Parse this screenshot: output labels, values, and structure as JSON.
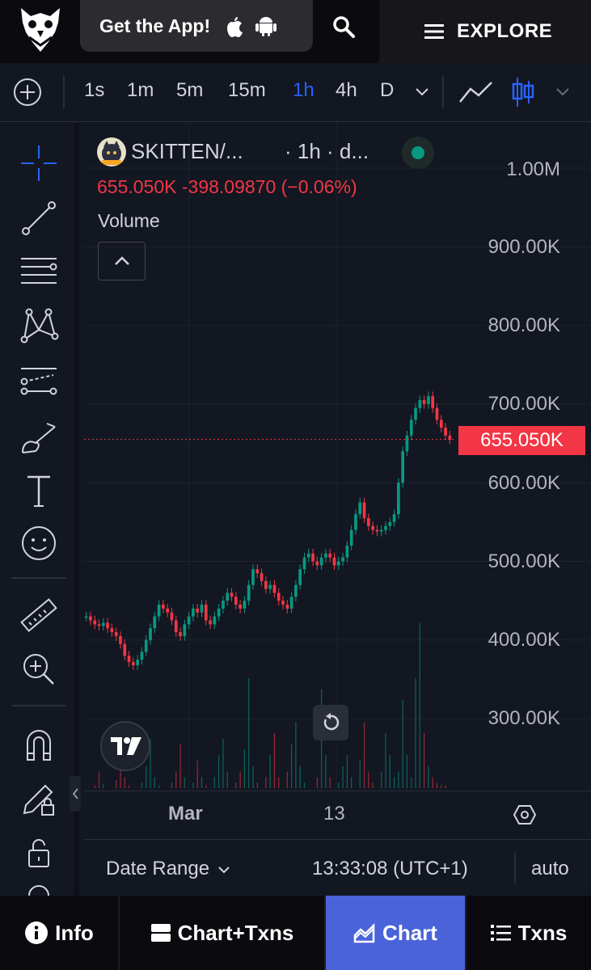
{
  "header": {
    "get_app_label": "Get the App!",
    "explore_label": "EXPLORE"
  },
  "toolbar": {
    "intervals": [
      "1s",
      "1m",
      "5m",
      "15m",
      "1h",
      "4h",
      "D"
    ],
    "active_interval": "1h"
  },
  "legend": {
    "symbol": "SKITTEN/...",
    "timeframe": "· 1h · d...",
    "ohlc": "655.050K  -398.09870 (−0.06%)",
    "volume_label": "Volume"
  },
  "price_axis": {
    "labels": [
      "1.00M",
      "900.00K",
      "800.00K",
      "700.00K",
      "600.00K",
      "500.00K",
      "400.00K",
      "300.00K"
    ],
    "current_price": "655.050K"
  },
  "time_axis": {
    "labels": [
      "Mar",
      "13"
    ]
  },
  "bottom_bar": {
    "date_range_label": "Date Range",
    "clock": "13:33:08 (UTC+1)",
    "scale_mode": "auto"
  },
  "tabs": [
    "Info",
    "Chart+Txns",
    "Chart",
    "Txns"
  ],
  "active_tab": "Chart",
  "colors": {
    "up": "#089981",
    "down": "#f23645",
    "accent": "#2962ff",
    "active_tab": "#4a63d9"
  },
  "chart_data": {
    "type": "candlestick",
    "ylim": [
      250000,
      1000000
    ],
    "price_series": [
      430000,
      425000,
      420000,
      418000,
      422000,
      415000,
      410000,
      405000,
      395000,
      380000,
      372000,
      368000,
      375000,
      385000,
      400000,
      415000,
      430000,
      445000,
      440000,
      435000,
      425000,
      410000,
      405000,
      420000,
      430000,
      440000,
      435000,
      445000,
      425000,
      420000,
      430000,
      440000,
      450000,
      460000,
      455000,
      445000,
      440000,
      450000,
      470000,
      490000,
      485000,
      475000,
      465000,
      470000,
      460000,
      450000,
      445000,
      440000,
      455000,
      470000,
      490000,
      505000,
      510000,
      500000,
      495000,
      505000,
      510000,
      505000,
      495000,
      500000,
      505000,
      520000,
      540000,
      560000,
      575000,
      555000,
      545000,
      540000,
      538000,
      540000,
      545000,
      550000,
      560000,
      600000,
      640000,
      660000,
      680000,
      695000,
      705000,
      700000,
      710000,
      695000,
      680000,
      670000,
      660000,
      655000
    ],
    "volume_spikes": [
      0,
      0,
      5,
      30,
      8,
      0,
      0,
      15,
      60,
      20,
      5,
      0,
      0,
      10,
      40,
      90,
      20,
      5,
      0,
      0,
      10,
      30,
      80,
      20,
      0,
      10,
      50,
      20,
      5,
      0,
      20,
      60,
      90,
      30,
      0,
      10,
      30,
      70,
      200,
      40,
      10,
      0,
      20,
      60,
      100,
      20,
      0,
      30,
      80,
      120,
      40,
      10,
      0,
      0,
      20,
      180,
      60,
      20,
      0,
      10,
      40,
      60,
      20,
      0,
      50,
      120,
      30,
      10,
      0,
      30,
      100,
      60,
      20,
      30,
      160,
      60,
      20,
      200,
      300,
      100,
      40,
      20,
      10,
      5,
      5,
      0
    ]
  }
}
